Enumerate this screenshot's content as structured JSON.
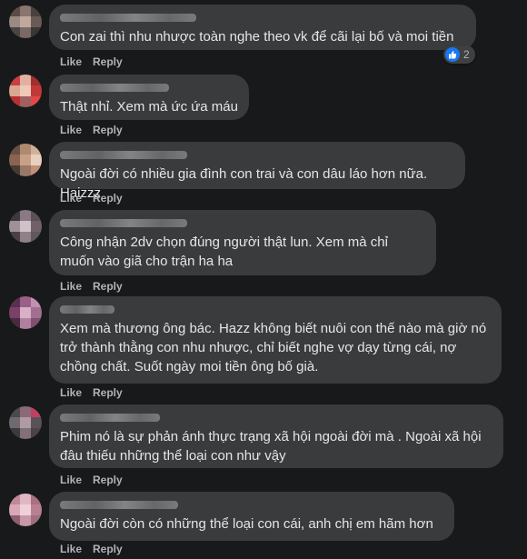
{
  "actions": {
    "like": "Like",
    "reply": "Reply"
  },
  "comments": [
    {
      "text": "Con zai thì nhu nhược toàn nghe theo vk để cãi lại bố và moi tiền",
      "reactions": "2"
    },
    {
      "text": "Thật nhỉ. Xem mà ức ứa máu"
    },
    {
      "text": "Ngoài đời có nhiều gia đình con trai và con dâu láo hơn nữa. Haizzz"
    },
    {
      "text": "Công nhận 2dv chọn đúng người thật lun. Xem mà chỉ muốn vào giã cho trận ha ha"
    },
    {
      "text": "Xem mà thương ông bác. Hazz không biết nuôi con thế nào mà giờ nó trở thành thằng con nhu nhược, chỉ biết nghe vợ dạy từng cái, nợ chồng chất. Suốt ngày moi tiền ông bố già."
    },
    {
      "text": "Phim nó là sự phản ánh thực trạng xã hội ngoài đời mà . Ngoài xã hội đâu thiếu những thể loại con như vậy"
    },
    {
      "text": "Ngoài đời còn có những thể loại con cái, anh chị em hãm hơn"
    }
  ],
  "colors": {
    "background": "#18191a",
    "bubble": "#3a3b3c",
    "action_text": "#b0b3b8",
    "like_blue": "#1877f2"
  },
  "icons": {
    "reaction": "thumbs-up-icon"
  }
}
